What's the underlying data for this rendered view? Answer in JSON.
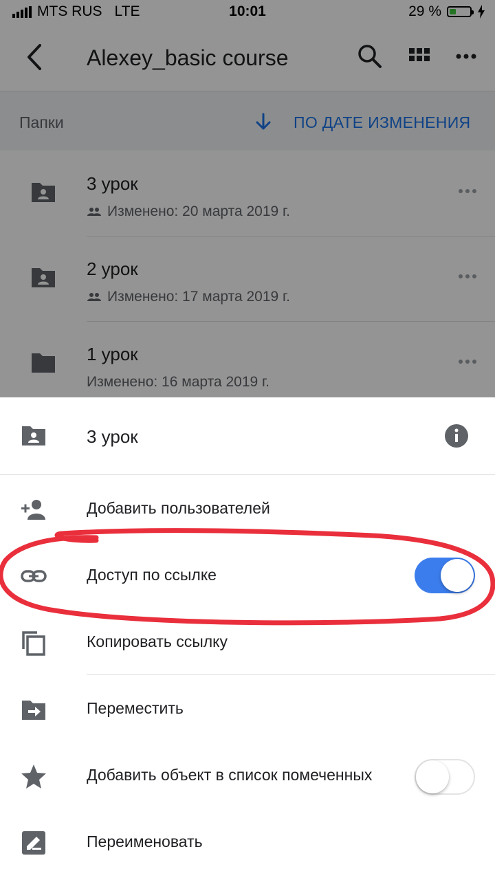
{
  "status_bar": {
    "carrier": "MTS RUS",
    "network": "LTE",
    "time": "10:01",
    "battery_percent": "29 %",
    "battery_level": 0.29
  },
  "toolbar": {
    "title": "Alexey_basic course",
    "icons": [
      "back-arrow-icon",
      "search-icon",
      "grid-view-icon",
      "more-horizontal-icon"
    ]
  },
  "sort_bar": {
    "section_label": "Папки",
    "sort_label": "ПО ДАТЕ ИЗМЕНЕНИЯ",
    "sort_color": "#1a73e8"
  },
  "folders": [
    {
      "name": "3 урок",
      "modified": "Изменено: 20 марта 2019 г.",
      "shared": true
    },
    {
      "name": "2 урок",
      "modified": "Изменено: 17 марта 2019 г.",
      "shared": true
    },
    {
      "name": "1 урок",
      "modified": "Изменено: 16 марта 2019 г.",
      "shared": false
    }
  ],
  "sheet": {
    "title": "3 урок",
    "items": [
      {
        "label": "Добавить пользователей",
        "icon": "person-add-icon"
      },
      {
        "label": "Доступ по ссылке",
        "icon": "link-icon",
        "toggle": true
      },
      {
        "label": "Копировать ссылку",
        "icon": "copy-icon"
      },
      {
        "label": "Переместить",
        "icon": "move-folder-icon"
      },
      {
        "label": "Добавить объект в список помеченных",
        "icon": "star-icon",
        "toggle": false
      },
      {
        "label": "Переименовать",
        "icon": "rename-icon"
      }
    ]
  },
  "colors": {
    "accent": "#3b7ded",
    "annotation": "#ea2f3c"
  }
}
